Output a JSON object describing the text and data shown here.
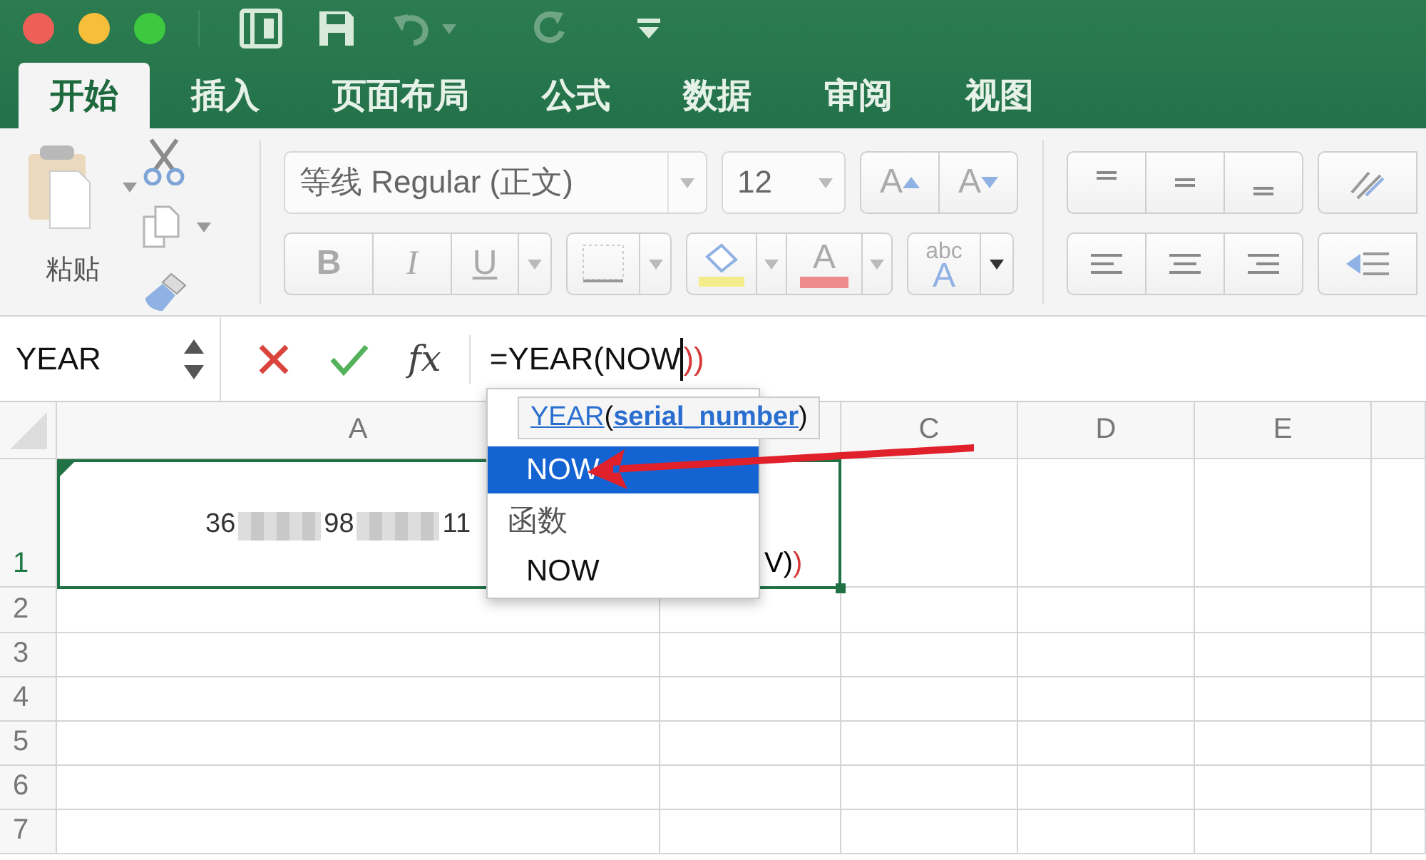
{
  "title_bar": {
    "window_controls": [
      {
        "color": "#ed5f57"
      },
      {
        "color": "#f6be3b"
      },
      {
        "color": "#3dc840"
      }
    ]
  },
  "tabs": [
    {
      "label": "开始",
      "selected": true
    },
    {
      "label": "插入",
      "selected": false
    },
    {
      "label": "页面布局",
      "selected": false
    },
    {
      "label": "公式",
      "selected": false
    },
    {
      "label": "数据",
      "selected": false
    },
    {
      "label": "审阅",
      "selected": false
    },
    {
      "label": "视图",
      "selected": false
    }
  ],
  "ribbon": {
    "paste_label": "粘贴",
    "font_name": "等线 Regular (正文)",
    "font_size": "12",
    "grow_font_label": "A",
    "shrink_font_label": "A",
    "bold_label": "B",
    "italic_label": "I",
    "underline_label": "U",
    "font_color_label": "A",
    "text_effect_label": "abc",
    "text_effect_letter": "A"
  },
  "formula_bar": {
    "name_box": "YEAR",
    "fx_label": "fx",
    "formula": "=YEAR(NOW",
    "formula_tail": "))"
  },
  "sheet": {
    "columns": [
      {
        "label": "A"
      },
      {
        "label": "C"
      },
      {
        "label": "D"
      },
      {
        "label": "E"
      }
    ],
    "rows": [
      {
        "label": "1",
        "selected": true
      },
      {
        "label": "2",
        "selected": false
      },
      {
        "label": "3",
        "selected": false
      },
      {
        "label": "4",
        "selected": false
      },
      {
        "label": "5",
        "selected": false
      },
      {
        "label": "6",
        "selected": false
      },
      {
        "label": "7",
        "selected": false
      }
    ],
    "a1_fragments": [
      "36",
      "98",
      "11"
    ],
    "b1": "V)",
    "b1_tail": ")"
  },
  "autocomplete": {
    "tooltip": {
      "function": "YEAR",
      "open_paren": "(",
      "argument": "serial_number",
      "close_paren": ")"
    },
    "items": [
      {
        "kind": "item",
        "label": "NOW",
        "selected": true
      },
      {
        "kind": "header",
        "label": "函数"
      },
      {
        "kind": "item",
        "label": "NOW",
        "selected": false
      }
    ]
  }
}
